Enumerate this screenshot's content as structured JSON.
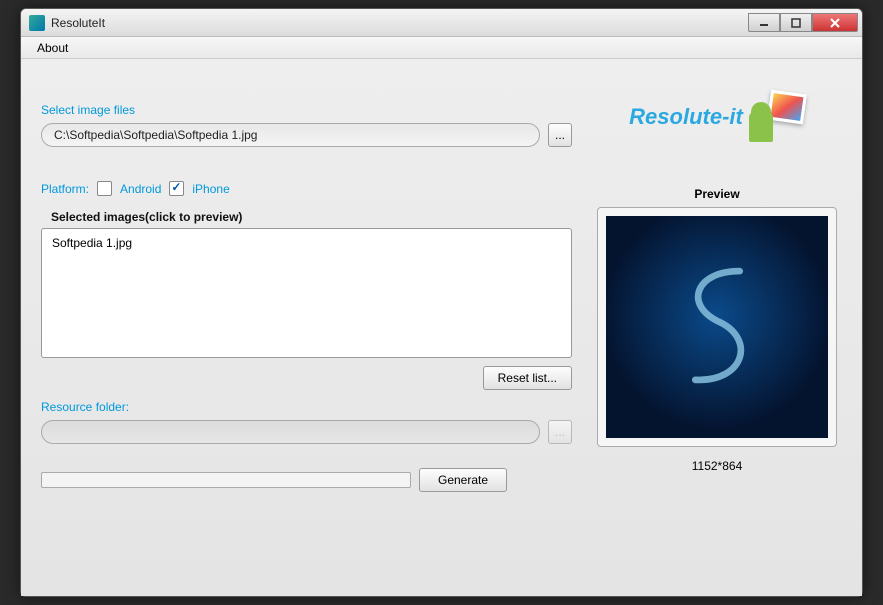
{
  "window": {
    "title": "ResoluteIt"
  },
  "menubar": {
    "about": "About"
  },
  "main": {
    "select_files_label": "Select image files",
    "file_path": "C:\\Softpedia\\Softpedia\\Softpedia 1.jpg",
    "browse_label": "...",
    "platform_label": "Platform:",
    "android_label": "Android",
    "android_checked": false,
    "iphone_label": "iPhone",
    "iphone_checked": true,
    "selected_images_label": "Selected images(click to preview)",
    "list_items": [
      "Softpedia 1.jpg"
    ],
    "reset_list_label": "Reset list...",
    "resource_folder_label": "Resource folder:",
    "resource_folder_value": "",
    "resource_browse_label": "...",
    "generate_label": "Generate"
  },
  "logo": {
    "text": "Resolute-it"
  },
  "preview": {
    "label": "Preview",
    "dimensions": "1152*864"
  }
}
